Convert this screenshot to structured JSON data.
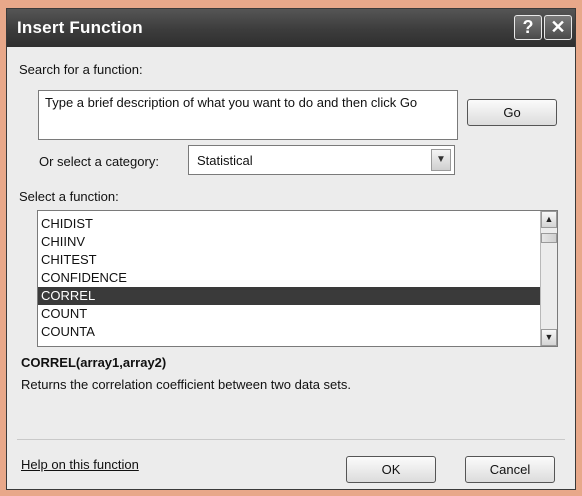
{
  "window": {
    "title": "Insert Function",
    "help_glyph": "?",
    "close_glyph": "✕"
  },
  "search": {
    "label": "Search for a function:",
    "value": "Type a brief description of what you want to do and then click Go",
    "go_label": "Go"
  },
  "category": {
    "label": "Or select a category:",
    "selected": "Statistical",
    "arrow_glyph": "▼"
  },
  "functions": {
    "label": "Select a function:",
    "items": [
      "CHIDIST",
      "CHIINV",
      "CHITEST",
      "CONFIDENCE",
      "CORREL",
      "COUNT",
      "COUNTA"
    ],
    "selected_index": 4,
    "scroll_up_glyph": "▲",
    "scroll_down_glyph": "▼"
  },
  "details": {
    "signature": "CORREL(array1,array2)",
    "description": "Returns the correlation coefficient between two data sets."
  },
  "footer": {
    "help_link": "Help on this function",
    "ok_label": "OK",
    "cancel_label": "Cancel"
  },
  "colors": {
    "background": "#e8a88a",
    "titlebar": "#3c3c3c",
    "selection": "#3a3a3a"
  },
  "icons": {
    "help": "help-icon",
    "close": "close-icon",
    "dropdown": "chevron-down-icon"
  }
}
